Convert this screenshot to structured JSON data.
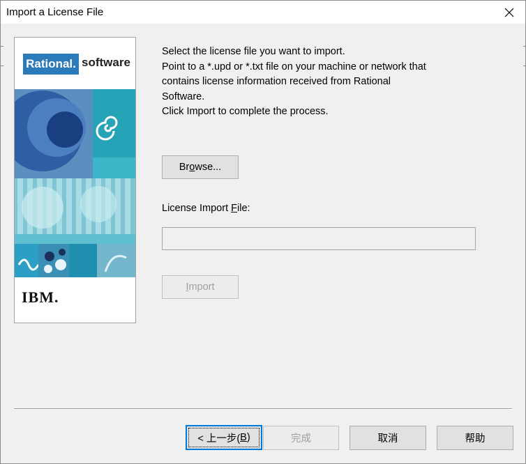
{
  "window": {
    "title": "Import a License File"
  },
  "banner": {
    "brand": "Rational.",
    "product": "software",
    "company": "IBM."
  },
  "instructions": {
    "lines": [
      "Select the license file you want to import.",
      "Point to a *.upd or *.txt file on your machine or network that",
      "contains license information received from Rational",
      "Software.",
      "Click Import to complete the process."
    ]
  },
  "browse": {
    "pre": "Br",
    "u": "o",
    "post": "wse..."
  },
  "field": {
    "pre": "License Import ",
    "u": "F",
    "post": "ile:",
    "value": ""
  },
  "import": {
    "pre": "",
    "u": "I",
    "post": "mport"
  },
  "footer": {
    "back_pre": "< 上一步(",
    "back_u": "B",
    "back_post": ")",
    "finish": "完成",
    "cancel": "取消",
    "help": "帮助"
  },
  "colors": {
    "accent": "#0078d7",
    "logo_blue": "#2b7ab9"
  }
}
